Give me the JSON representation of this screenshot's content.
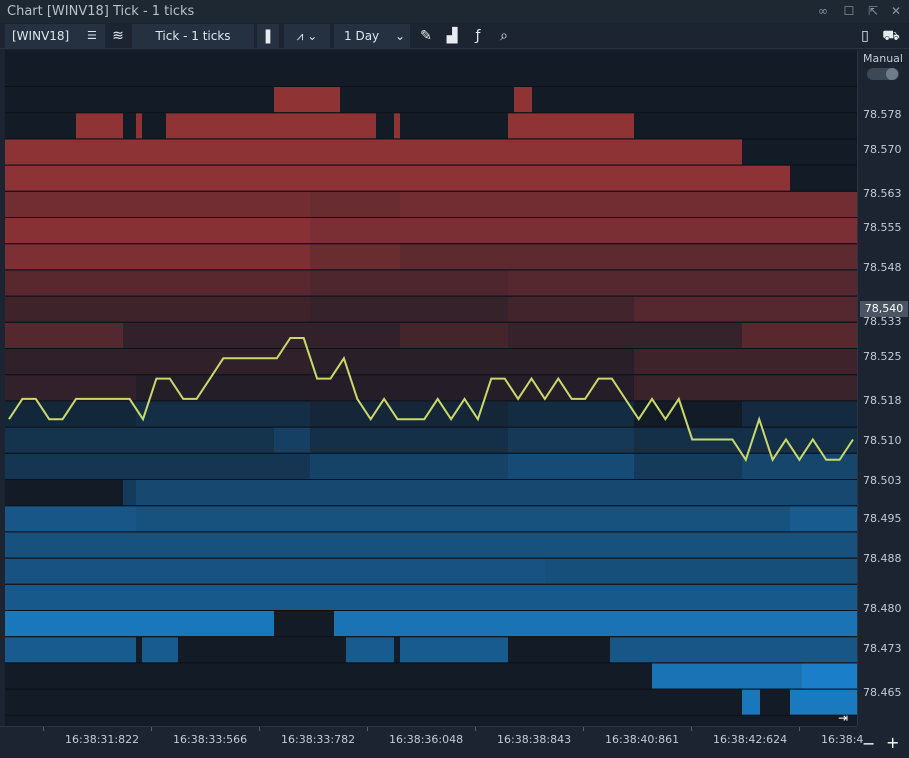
{
  "window": {
    "title": "Chart [WINV18] Tick - 1 ticks"
  },
  "toolbar": {
    "symbol": "[WINV18]",
    "chart_type_label": "Tick - 1 ticks",
    "period_label": "1 Day",
    "icons": [
      "list-icon",
      "overlay-icon",
      "candlestick-icon",
      "line-style-icon",
      "pencil-icon",
      "bar-chart-icon",
      "studies-icon",
      "zoom-icon",
      "portrait-icon",
      "cart-icon"
    ]
  },
  "price_axis": {
    "labels": [
      "78.578",
      "78.570",
      "78.563",
      "78.555",
      "78.548",
      "78.533",
      "78.525",
      "78.518",
      "78.510",
      "78.503",
      "78.495",
      "78.488",
      "78.480",
      "78.473",
      "78.465"
    ],
    "current_price": "78,540",
    "manual_label": "Manual"
  },
  "time_axis": {
    "labels": [
      "16:38:31:822",
      "16:38:33:566",
      "16:38:33:782",
      "16:38:36:048",
      "16:38:38:843",
      "16:38:40:861",
      "16:38:42:624",
      "16:38:4"
    ]
  },
  "chart_data": {
    "type": "heatmap",
    "title": "",
    "x_categories": [
      "16:38:31:822",
      "16:38:33:566",
      "16:38:33:782",
      "16:38:36:048",
      "16:38:38:843",
      "16:38:40:861",
      "16:38:42:624"
    ],
    "price_levels": [
      78.585,
      78.58,
      78.575,
      78.57,
      78.565,
      78.56,
      78.555,
      78.55,
      78.545,
      78.54,
      78.535,
      78.53,
      78.525,
      78.52,
      78.515,
      78.51,
      78.505,
      78.5,
      78.495,
      78.49,
      78.485,
      78.48,
      78.475,
      78.47,
      78.465
    ],
    "price_series": {
      "name": "",
      "color": "#c8d96a",
      "values": [
        78.525,
        78.53,
        78.53,
        78.525,
        78.525,
        78.53,
        78.53,
        78.53,
        78.53,
        78.53,
        78.525,
        78.535,
        78.535,
        78.53,
        78.53,
        78.535,
        78.54,
        78.54,
        78.54,
        78.54,
        78.54,
        78.545,
        78.545,
        78.535,
        78.535,
        78.54,
        78.53,
        78.525,
        78.53,
        78.525,
        78.525,
        78.525,
        78.53,
        78.525,
        78.53,
        78.525,
        78.535,
        78.535,
        78.53,
        78.535,
        78.53,
        78.535,
        78.53,
        78.53,
        78.535,
        78.535,
        78.53,
        78.525,
        78.53,
        78.525,
        78.53,
        78.52,
        78.52,
        78.52,
        78.52,
        78.515,
        78.525,
        78.515,
        78.52,
        78.515,
        78.52,
        78.515,
        78.515,
        78.52
      ]
    },
    "colors": {
      "ask": "#b03a3a",
      "bid": "#1b87d6",
      "background": "#131b26",
      "price_line": "#c8d96a"
    },
    "ylim": [
      78.462,
      78.588
    ],
    "grid": true
  }
}
